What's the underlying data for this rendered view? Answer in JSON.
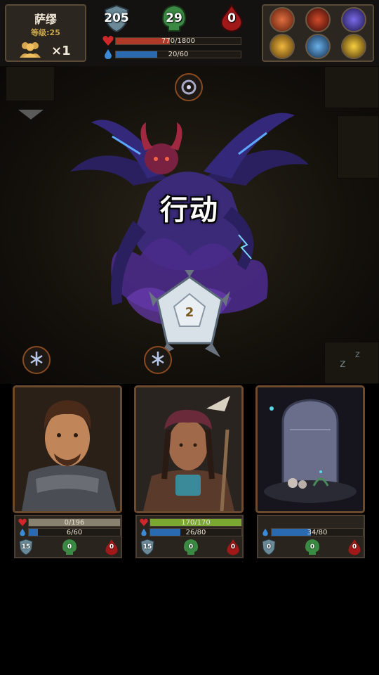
{
  "player": {
    "name": "萨缪",
    "level_text": "等级:25",
    "party_count": "×1"
  },
  "stats": {
    "armor": "205",
    "poison": "29",
    "blood": "0"
  },
  "bars": {
    "hp_text": "770/1800",
    "hp_fraction": 0.43,
    "mana_text": "20/60",
    "mana_fraction": 0.33
  },
  "skills": [
    {
      "icon": "fire-slash-icon",
      "color": "#b84020"
    },
    {
      "icon": "flame-burst-icon",
      "color": "#a8301c"
    },
    {
      "icon": "arcane-crystal-icon",
      "color": "#4a3ab8"
    },
    {
      "icon": "golden-fist-icon",
      "color": "#c8901c"
    },
    {
      "icon": "frost-beast-icon",
      "color": "#3a7ab8"
    },
    {
      "icon": "golden-claw-icon",
      "color": "#d0a020"
    }
  ],
  "battle": {
    "action_label": "行动",
    "dice_value": "2"
  },
  "heroes": [
    {
      "name": "armored-warrior",
      "hp_text": "0/196",
      "hp_fraction": 0,
      "mana_text": "6/60",
      "mana_fraction": 0.1,
      "armor": "15",
      "poison": "0",
      "blood": "0"
    },
    {
      "name": "tribal-shaman",
      "hp_text": "170/170",
      "hp_fraction": 1,
      "mana_text": "26/80",
      "mana_fraction": 0.33,
      "armor": "15",
      "poison": "0",
      "blood": "0"
    },
    {
      "name": "tombstone",
      "mana_text": "34/80",
      "mana_fraction": 0.43,
      "armor": "0",
      "poison": "0",
      "blood": "0"
    }
  ],
  "colors": {
    "hp": "#c0392b",
    "mana": "#2a6ab0",
    "hero_hp": "#7aa830",
    "hero_hp_empty": "#8a8270"
  }
}
